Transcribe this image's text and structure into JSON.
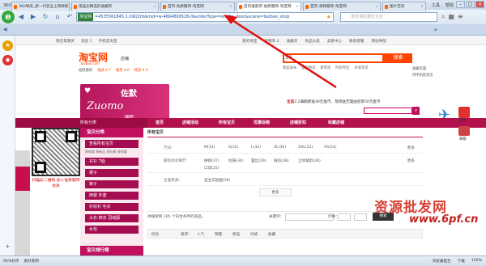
{
  "browser": {
    "title": "360安全浏览器 6.3",
    "menu": [
      "文件",
      "查看",
      "收藏",
      "工具",
      "帮助"
    ],
    "site_badge": "淘宝网",
    "url": "=4535361845.1.h9Q2rb&mid=w-4664899528-0&orderType=newOn_desc&scene=taobao_shop",
    "search_placeholder": "单反相机报价大全",
    "tabs": [
      "360导航_新一代安全上网导航",
      "饱品乐精选的收藏夹",
      "首页-佐默服饰-淘宝网",
      "店内搜索页-佐默服饰-淘宝网",
      "首页-源辉服饰-淘宝网",
      "图片空间"
    ],
    "status_left": [
      "90%好评",
      "爱好客网"
    ],
    "status_right": [
      "浏览器医生",
      "下载",
      "100%"
    ]
  },
  "taobao": {
    "top_left": [
      "我在帮我买",
      "消息 1",
      "手机逛淘宝"
    ],
    "top_right": [
      "我的淘宝",
      "购物车 4",
      "收藏夹",
      "商品分类",
      "卖家中心",
      "联系客服",
      "网站导航"
    ],
    "logo": "淘宝网",
    "logo_sub": "Taobao.com",
    "shop_label": "店铺",
    "search_cat": "宝贝",
    "search_button": "搜索",
    "search_links": [
      "新品发布",
      "爆品特卖",
      "新到货",
      "时尚专区",
      "开关淘宝"
    ],
    "rating_shop": "佐默服饰",
    "rating": [
      "描述 4.7",
      "服务 4.6",
      "物流 4.5"
    ],
    "collect": [
      "收藏店铺",
      "用手机逛淘宝"
    ],
    "promo_prefix": "全店",
    "promo_text": "2.2满额即送30元金币，现场送无理由退货50元金币",
    "brand_cn": "佐默",
    "brand_en": "Zuomo",
    "brand_tag": "美佳",
    "nav_allcat": "所有分类",
    "nav_items": [
      "首页",
      "店铺活动",
      "所有宝贝",
      "优惠促销",
      "店铺折扣",
      "收藏店铺"
    ],
    "qr_text": "扫描此二维码 加入佐默服饰会员",
    "cat_head": "宝贝分类",
    "cats": [
      {
        "label": "查看所有宝贝",
        "sub": "按销量 按新品 按价格 按收藏"
      },
      {
        "label": "衬衫 T恤",
        "sub": ""
      },
      {
        "label": "裙子",
        "sub": ""
      },
      {
        "label": "裤子",
        "sub": ""
      },
      {
        "label": "西装 外套",
        "sub": ""
      },
      {
        "label": "针织衫 毛衣",
        "sub": ""
      },
      {
        "label": "大衣 棉衣 羽绒服",
        "sub": ""
      },
      {
        "label": "女包",
        "sub": ""
      }
    ],
    "cat_foot": "宝贝排行榜",
    "main_title": "所有宝贝",
    "attr": [
      {
        "label": "尺码：",
        "values": [
          "M(33)",
          "S(32)",
          "L(32)",
          "XL(30)",
          "XXL(22)",
          "XS(24)"
        ],
        "more": "更多"
      },
      {
        "label": "服装款式细节：",
        "values": [
          "拼接(37)",
          "拉链(34)",
          "蕾丝(29)",
          "纽扣(28)",
          "立体裁剪(26)",
          "口袋(25)"
        ],
        "more": "更多"
      },
      {
        "label": "主图来源：",
        "values": [
          "自主实拍图(36)"
        ],
        "more": ""
      }
    ],
    "more_btn": "更多",
    "results_text": "共搜索到 105 个符合条件的商品。",
    "kw_label": "关键字：",
    "price_label": "价格：",
    "search_btn2": "搜索",
    "sort_items": [
      "综合",
      "排序：",
      "人气",
      "销量",
      "新品",
      "价格",
      "收藏"
    ],
    "watermark_cn": "资源批发网",
    "watermark_en": "www.6pf.cn"
  },
  "sidebar_right": [
    "活动",
    "邮箱"
  ]
}
